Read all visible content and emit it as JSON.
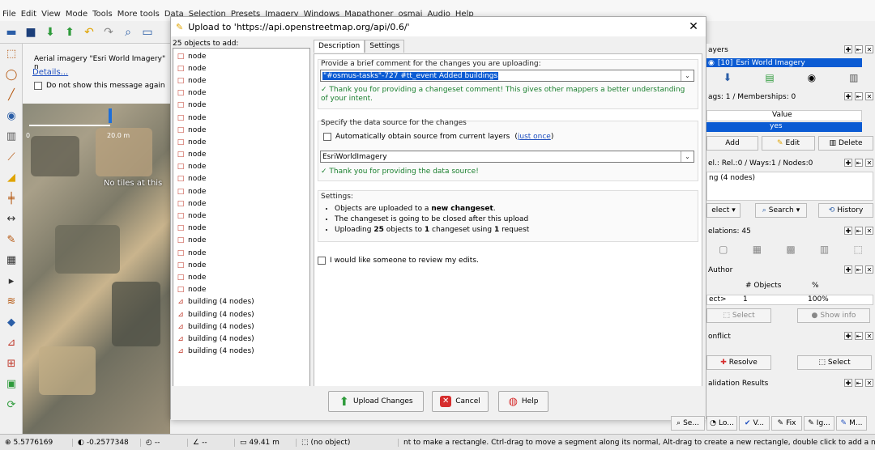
{
  "app": {
    "title": "Java OpenStreetMap Editor"
  },
  "menu": [
    "File",
    "Edit",
    "View",
    "Mode",
    "Tools",
    "More tools",
    "Data",
    "Selection",
    "Presets",
    "Imagery",
    "Windows",
    "Mapathoner",
    "osmai",
    "Audio",
    "Help"
  ],
  "aerial": {
    "title": "Aerial imagery \"Esri World Imagery\" n",
    "details": "Details...",
    "dont_show": "Do not show this message again"
  },
  "map": {
    "scale_left": "0",
    "scale_right": "20.0 m",
    "no_tiles": "No tiles at this"
  },
  "dialog": {
    "title": "Upload to 'https://api.openstreetmap.org/api/0.6/'",
    "objects_header": "25 objects to add:",
    "objects": [
      "node",
      "node",
      "node",
      "node",
      "node",
      "node",
      "node",
      "node",
      "node",
      "node",
      "node",
      "node",
      "node",
      "node",
      "node",
      "node",
      "node",
      "node",
      "node",
      "node",
      "building (4 nodes)",
      "building (4 nodes)",
      "building (4 nodes)",
      "building (4 nodes)",
      "building (4 nodes)"
    ],
    "tabs": [
      "Description",
      "Settings"
    ],
    "comment_label": "Provide a brief comment for the changes you are uploading:",
    "comment_value": "\"#osmus-tasks\"-727 #tt_event Added buildings",
    "comment_ok": "Thank you for providing a changeset comment! This gives other mappers a better understanding of your intent.",
    "source_label": "Specify the data source for the changes",
    "auto_source": "Automatically obtain source from current layers",
    "just_once": "just once",
    "source_value": "EsriWorldImagery",
    "source_ok": "Thank you for providing the data source!",
    "settings_label": "Settings:",
    "settings_items_html": [
      "Objects are uploaded to a <b>new changeset</b>.",
      "The changeset is going to be closed after this upload",
      "Uploading <b>25</b> objects to <b>1</b> changeset using <b>1</b> request"
    ],
    "review": "I would like someone to review my edits.",
    "buttons": {
      "upload": "Upload Changes",
      "cancel": "Cancel",
      "help": "Help"
    }
  },
  "right": {
    "layers_title": "ayers",
    "layer_name": "Esri World Imagery",
    "layer_count": "[10]",
    "tags_title": "ags: 1 / Memberships: 0",
    "value_col": "Value",
    "value_row": "yes",
    "add": "Add",
    "edit": "Edit",
    "delete": "Delete",
    "sel_title": "el.: Rel.:0 / Ways:1 / Nodes:0",
    "sel_item": "ng (4 nodes)",
    "select": "elect",
    "search": "Search",
    "history": "History",
    "relations_title": "elations: 45",
    "author_title": "Author",
    "objects_col": "# Objects",
    "pct_col": "%",
    "author_row": "ect>",
    "author_count": "1",
    "author_pct": "100%",
    "select2": "Select",
    "show_info": "Show info",
    "conflict_title": "onflict",
    "resolve": "Resolve",
    "select3": "Select",
    "validation_title": "alidation Results",
    "bottom_tabs": [
      "Se...",
      "Lo...",
      "V...",
      "Fix",
      "Ig...",
      "M..."
    ]
  },
  "status": {
    "lat": "5.5776169",
    "lon": "-0.2577348",
    "heading": "--",
    "angle": "--",
    "distance": "49.41 m",
    "selection": "(no object)",
    "message": "nt to make a rectangle. Ctrl-drag to move a segment along its normal, Alt-drag to create a new rectangle, double click to add a new node."
  },
  "colors": {
    "selected": "#0b5bd3",
    "ok": "#1a7f2e",
    "link": "#1f4fbf"
  }
}
